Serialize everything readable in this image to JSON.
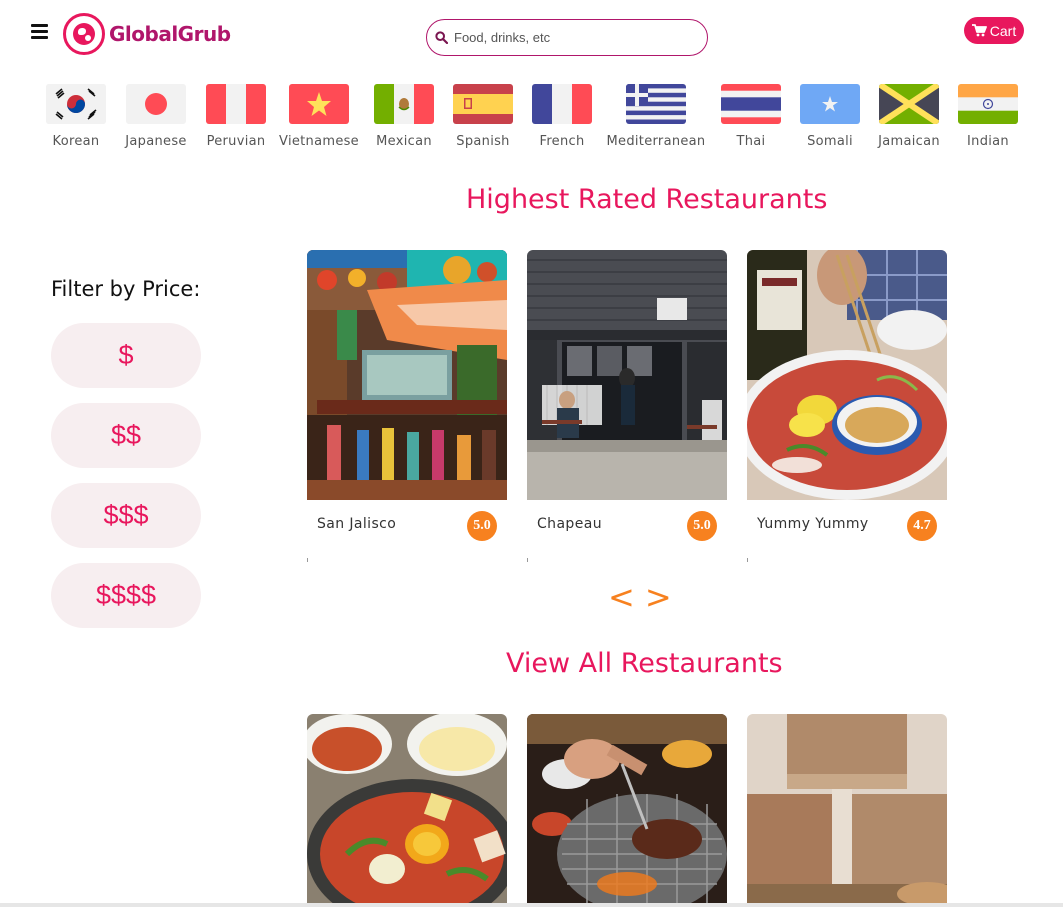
{
  "header": {
    "brand": "GlobalGrub",
    "search_placeholder": "Food, drinks, etc",
    "search_value": "",
    "cart_label": "Cart",
    "brand_color": "#e8175d"
  },
  "cuisines": [
    {
      "label": "Korean",
      "icon": "korea-flag-icon"
    },
    {
      "label": "Japanese",
      "icon": "japan-flag-icon"
    },
    {
      "label": "Peruvian",
      "icon": "peru-flag-icon"
    },
    {
      "label": "Vietnamese",
      "icon": "vietnam-flag-icon"
    },
    {
      "label": "Mexican",
      "icon": "mexico-flag-icon"
    },
    {
      "label": "Spanish",
      "icon": "spain-flag-icon"
    },
    {
      "label": "French",
      "icon": "france-flag-icon"
    },
    {
      "label": "Mediterranean",
      "icon": "greece-flag-icon"
    },
    {
      "label": "Thai",
      "icon": "thailand-flag-icon"
    },
    {
      "label": "Somali",
      "icon": "somalia-flag-icon"
    },
    {
      "label": "Jamaican",
      "icon": "jamaica-flag-icon"
    },
    {
      "label": "Indian",
      "icon": "india-flag-icon"
    }
  ],
  "highest_rated": {
    "title": "Highest Rated Restaurants",
    "restaurants": [
      {
        "name": "San Jalisco",
        "rating": "5.0"
      },
      {
        "name": "Chapeau",
        "rating": "5.0"
      },
      {
        "name": "Yummy Yummy",
        "rating": "4.7"
      }
    ],
    "prev_label": "<",
    "next_label": ">"
  },
  "filter": {
    "title": "Filter by Price:",
    "options": [
      "$",
      "$$",
      "$$$",
      "$$$$"
    ]
  },
  "all_restaurants": {
    "title": "View All Restaurants"
  },
  "accent_colors": {
    "pink": "#e8175d",
    "orange": "#f7811f",
    "pill_bg": "#f7eef0"
  }
}
